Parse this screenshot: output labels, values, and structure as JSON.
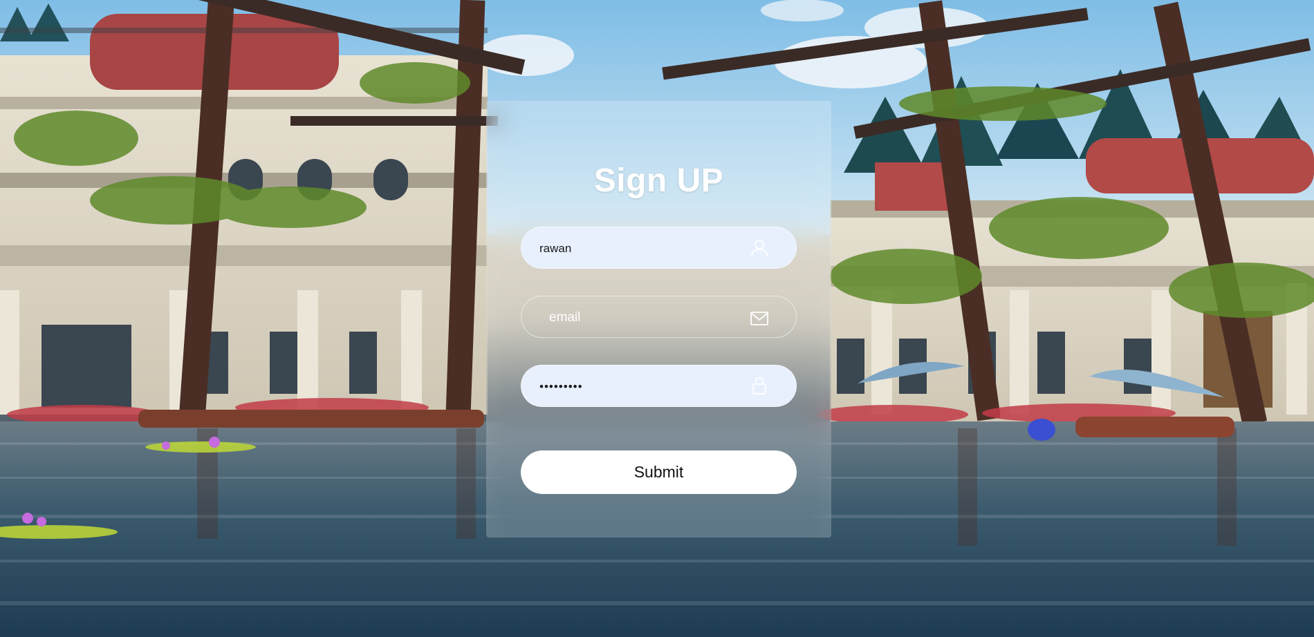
{
  "form": {
    "title": "Sign UP",
    "username": {
      "value": "rawan",
      "icon": "user-icon"
    },
    "email": {
      "placeholder": "email",
      "value": "",
      "icon": "mail-icon"
    },
    "password": {
      "masked_value": "•••••••••",
      "icon": "lock-icon"
    },
    "submit_label": "Submit"
  },
  "colors": {
    "panel_glass": "rgba(255,255,255,0.18)",
    "input_filled_bg": "#e8f0fe",
    "title_text": "#ffffff",
    "button_bg": "#ffffff",
    "button_text": "#111111"
  }
}
